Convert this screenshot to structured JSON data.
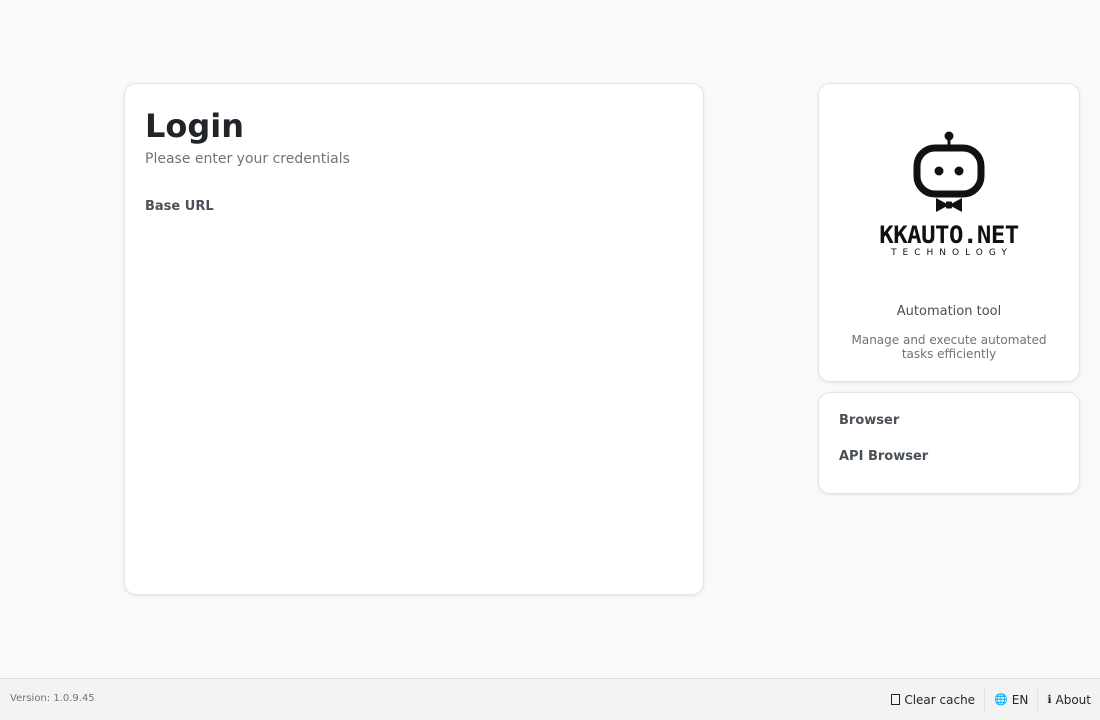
{
  "login": {
    "title": "Login",
    "subtitle": "Please enter your credentials",
    "base_url_label": "Base URL"
  },
  "brand": {
    "name": "KKAUTO.NET",
    "tagline": "TECHNOLOGY",
    "tool_name": "Automation tool",
    "tool_description": "Manage and execute automated tasks efficiently"
  },
  "links": {
    "browser": "Browser",
    "api_browser": "API Browser"
  },
  "footer": {
    "version": "Version: 1.0.9.45",
    "clear_cache": "Clear cache",
    "language": "EN",
    "about": "About"
  },
  "icons": {
    "clear_cache": "trash-icon",
    "language": "globe-icon",
    "about": "info-icon",
    "logo": "robot-logo-icon"
  },
  "colors": {
    "background": "#f8f9fa",
    "card": "#ffffff",
    "text": "#212529",
    "muted": "#6c757d",
    "border": "#dee2e6"
  }
}
